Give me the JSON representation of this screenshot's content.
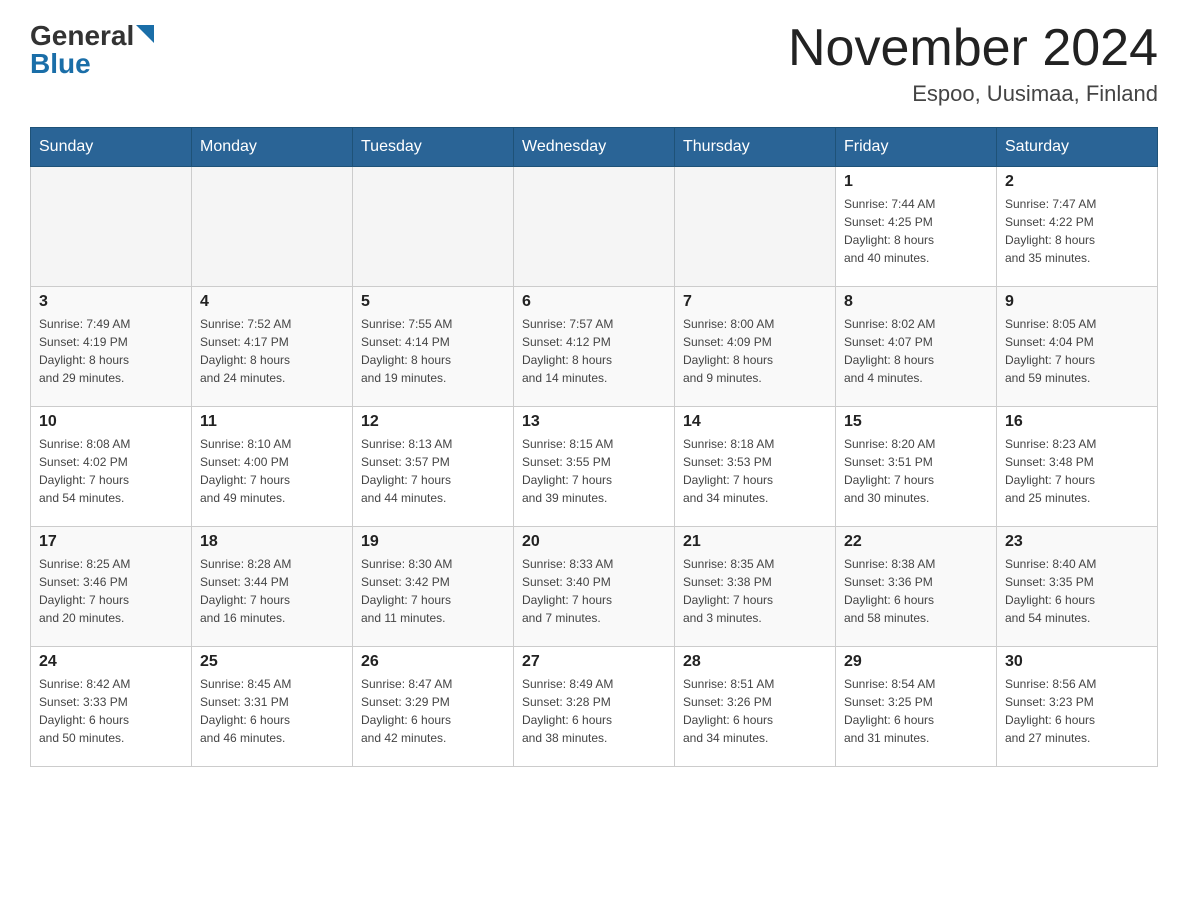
{
  "header": {
    "logo_text_black": "General",
    "logo_text_blue": "Blue",
    "month_title": "November 2024",
    "location": "Espoo, Uusimaa, Finland"
  },
  "days_of_week": [
    "Sunday",
    "Monday",
    "Tuesday",
    "Wednesday",
    "Thursday",
    "Friday",
    "Saturday"
  ],
  "weeks": [
    [
      {
        "day": "",
        "info": ""
      },
      {
        "day": "",
        "info": ""
      },
      {
        "day": "",
        "info": ""
      },
      {
        "day": "",
        "info": ""
      },
      {
        "day": "",
        "info": ""
      },
      {
        "day": "1",
        "info": "Sunrise: 7:44 AM\nSunset: 4:25 PM\nDaylight: 8 hours\nand 40 minutes."
      },
      {
        "day": "2",
        "info": "Sunrise: 7:47 AM\nSunset: 4:22 PM\nDaylight: 8 hours\nand 35 minutes."
      }
    ],
    [
      {
        "day": "3",
        "info": "Sunrise: 7:49 AM\nSunset: 4:19 PM\nDaylight: 8 hours\nand 29 minutes."
      },
      {
        "day": "4",
        "info": "Sunrise: 7:52 AM\nSunset: 4:17 PM\nDaylight: 8 hours\nand 24 minutes."
      },
      {
        "day": "5",
        "info": "Sunrise: 7:55 AM\nSunset: 4:14 PM\nDaylight: 8 hours\nand 19 minutes."
      },
      {
        "day": "6",
        "info": "Sunrise: 7:57 AM\nSunset: 4:12 PM\nDaylight: 8 hours\nand 14 minutes."
      },
      {
        "day": "7",
        "info": "Sunrise: 8:00 AM\nSunset: 4:09 PM\nDaylight: 8 hours\nand 9 minutes."
      },
      {
        "day": "8",
        "info": "Sunrise: 8:02 AM\nSunset: 4:07 PM\nDaylight: 8 hours\nand 4 minutes."
      },
      {
        "day": "9",
        "info": "Sunrise: 8:05 AM\nSunset: 4:04 PM\nDaylight: 7 hours\nand 59 minutes."
      }
    ],
    [
      {
        "day": "10",
        "info": "Sunrise: 8:08 AM\nSunset: 4:02 PM\nDaylight: 7 hours\nand 54 minutes."
      },
      {
        "day": "11",
        "info": "Sunrise: 8:10 AM\nSunset: 4:00 PM\nDaylight: 7 hours\nand 49 minutes."
      },
      {
        "day": "12",
        "info": "Sunrise: 8:13 AM\nSunset: 3:57 PM\nDaylight: 7 hours\nand 44 minutes."
      },
      {
        "day": "13",
        "info": "Sunrise: 8:15 AM\nSunset: 3:55 PM\nDaylight: 7 hours\nand 39 minutes."
      },
      {
        "day": "14",
        "info": "Sunrise: 8:18 AM\nSunset: 3:53 PM\nDaylight: 7 hours\nand 34 minutes."
      },
      {
        "day": "15",
        "info": "Sunrise: 8:20 AM\nSunset: 3:51 PM\nDaylight: 7 hours\nand 30 minutes."
      },
      {
        "day": "16",
        "info": "Sunrise: 8:23 AM\nSunset: 3:48 PM\nDaylight: 7 hours\nand 25 minutes."
      }
    ],
    [
      {
        "day": "17",
        "info": "Sunrise: 8:25 AM\nSunset: 3:46 PM\nDaylight: 7 hours\nand 20 minutes."
      },
      {
        "day": "18",
        "info": "Sunrise: 8:28 AM\nSunset: 3:44 PM\nDaylight: 7 hours\nand 16 minutes."
      },
      {
        "day": "19",
        "info": "Sunrise: 8:30 AM\nSunset: 3:42 PM\nDaylight: 7 hours\nand 11 minutes."
      },
      {
        "day": "20",
        "info": "Sunrise: 8:33 AM\nSunset: 3:40 PM\nDaylight: 7 hours\nand 7 minutes."
      },
      {
        "day": "21",
        "info": "Sunrise: 8:35 AM\nSunset: 3:38 PM\nDaylight: 7 hours\nand 3 minutes."
      },
      {
        "day": "22",
        "info": "Sunrise: 8:38 AM\nSunset: 3:36 PM\nDaylight: 6 hours\nand 58 minutes."
      },
      {
        "day": "23",
        "info": "Sunrise: 8:40 AM\nSunset: 3:35 PM\nDaylight: 6 hours\nand 54 minutes."
      }
    ],
    [
      {
        "day": "24",
        "info": "Sunrise: 8:42 AM\nSunset: 3:33 PM\nDaylight: 6 hours\nand 50 minutes."
      },
      {
        "day": "25",
        "info": "Sunrise: 8:45 AM\nSunset: 3:31 PM\nDaylight: 6 hours\nand 46 minutes."
      },
      {
        "day": "26",
        "info": "Sunrise: 8:47 AM\nSunset: 3:29 PM\nDaylight: 6 hours\nand 42 minutes."
      },
      {
        "day": "27",
        "info": "Sunrise: 8:49 AM\nSunset: 3:28 PM\nDaylight: 6 hours\nand 38 minutes."
      },
      {
        "day": "28",
        "info": "Sunrise: 8:51 AM\nSunset: 3:26 PM\nDaylight: 6 hours\nand 34 minutes."
      },
      {
        "day": "29",
        "info": "Sunrise: 8:54 AM\nSunset: 3:25 PM\nDaylight: 6 hours\nand 31 minutes."
      },
      {
        "day": "30",
        "info": "Sunrise: 8:56 AM\nSunset: 3:23 PM\nDaylight: 6 hours\nand 27 minutes."
      }
    ]
  ]
}
